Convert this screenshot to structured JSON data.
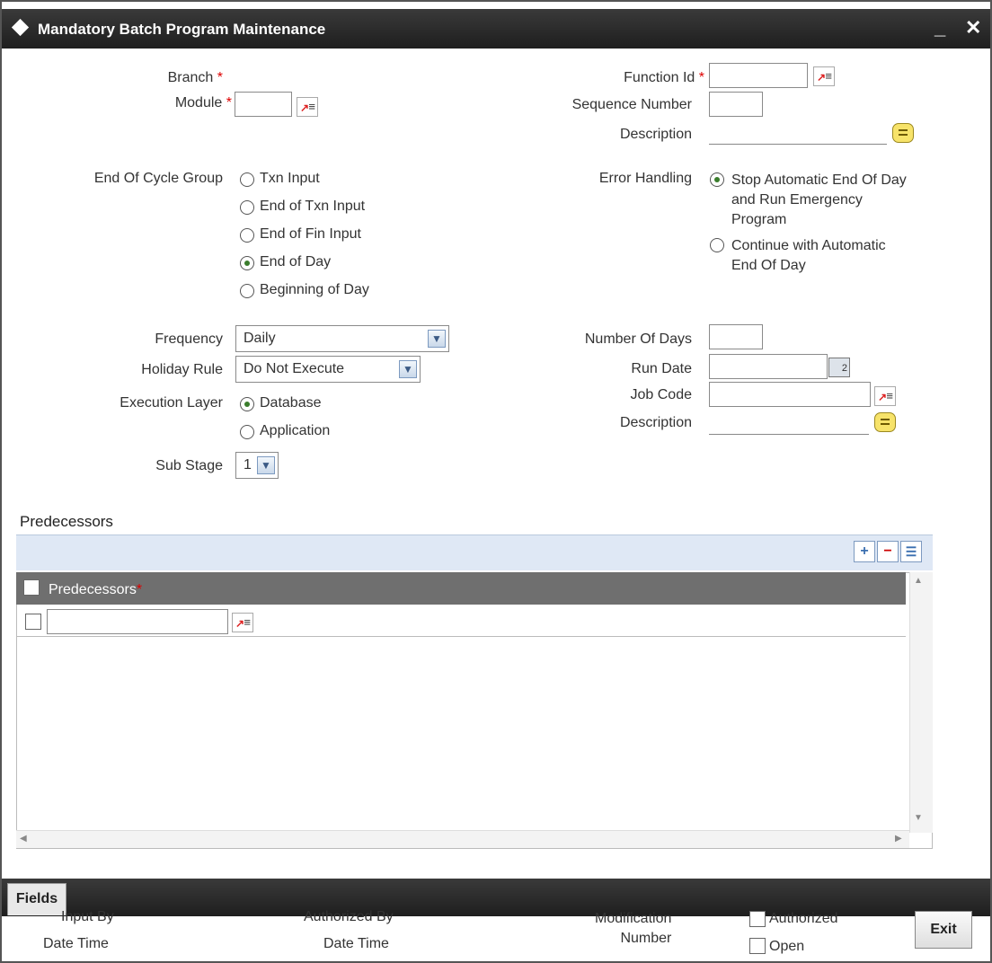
{
  "window": {
    "title": "Mandatory Batch Program Maintenance",
    "minimize": "_",
    "close": "✕"
  },
  "form": {
    "branch_label": "Branch",
    "module_label": "Module",
    "function_id_label": "Function Id",
    "sequence_number_label": "Sequence Number",
    "description_label": "Description",
    "required_mark": "*",
    "end_of_cycle_group": {
      "label": "End Of Cycle Group",
      "options": [
        "Txn Input",
        "End of Txn Input",
        "End of Fin Input",
        "End of Day",
        "Beginning of Day"
      ],
      "selected": "End of Day"
    },
    "error_handling": {
      "label": "Error Handling",
      "options": [
        [
          "Stop Automatic End Of Day",
          "and Run Emergency",
          "Program"
        ],
        [
          "Continue with Automatic",
          "End Of Day"
        ]
      ],
      "selected_index": 0
    },
    "frequency": {
      "label": "Frequency",
      "value": "Daily"
    },
    "holiday_rule": {
      "label": "Holiday Rule",
      "value": "Do Not Execute"
    },
    "execution_layer": {
      "label": "Execution Layer",
      "options": [
        "Database",
        "Application"
      ],
      "selected": "Database"
    },
    "sub_stage": {
      "label": "Sub Stage",
      "value": "1"
    },
    "number_of_days_label": "Number Of Days",
    "run_date_label": "Run Date",
    "job_code_label": "Job Code",
    "description2_label": "Description"
  },
  "predecessors": {
    "section_title": "Predecessors",
    "column_header": "Predecessors",
    "toolbar": {
      "add": "+",
      "delete": "−",
      "view": "☰"
    }
  },
  "footer": {
    "tab_label": "Fields",
    "input_by": "Input By",
    "date_time_1": "Date Time",
    "authorized_by": "Authorized By",
    "date_time_2": "Date Time",
    "modification_number": [
      "Modification",
      "Number"
    ],
    "authorized": "Authorized",
    "open": "Open",
    "exit": "Exit"
  },
  "colors": {
    "titlebar": "#2a2a2a",
    "required": "#dd0000",
    "grid_header": "#6f6f6f",
    "toolbar_bg": "#dfe8f5"
  }
}
